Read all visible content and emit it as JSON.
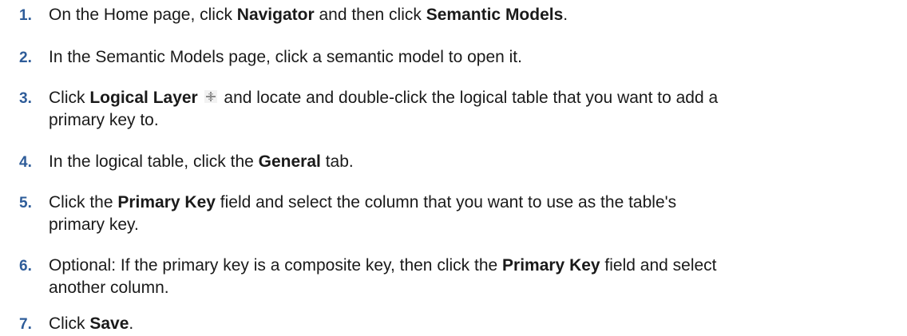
{
  "steps": [
    {
      "number": "1.",
      "parts": [
        "On the Home page, click ",
        "Navigator",
        " and then click ",
        "Semantic Models",
        "."
      ]
    },
    {
      "number": "2.",
      "parts": [
        "In the Semantic Models page, click a semantic model to open it."
      ]
    },
    {
      "number": "3.",
      "parts": [
        "Click ",
        "Logical Layer",
        " and locate and double-click the logical table that you want to add a",
        "primary key to."
      ],
      "icon": "logical-layer-icon"
    },
    {
      "number": "4.",
      "parts": [
        "In the logical table, click the ",
        "General",
        " tab."
      ]
    },
    {
      "number": "5.",
      "parts": [
        "Click the ",
        "Primary Key",
        " field and select the column that you want to use as the table's",
        "primary key."
      ]
    },
    {
      "number": "6.",
      "parts": [
        "Optional: If the primary key is a composite key, then click the ",
        "Primary Key",
        " field and select",
        "another column."
      ]
    },
    {
      "number": "7.",
      "parts": [
        "Click ",
        "Save",
        "."
      ]
    }
  ],
  "colors": {
    "step_number": "#2e5c99",
    "text": "#1a1a1a"
  }
}
